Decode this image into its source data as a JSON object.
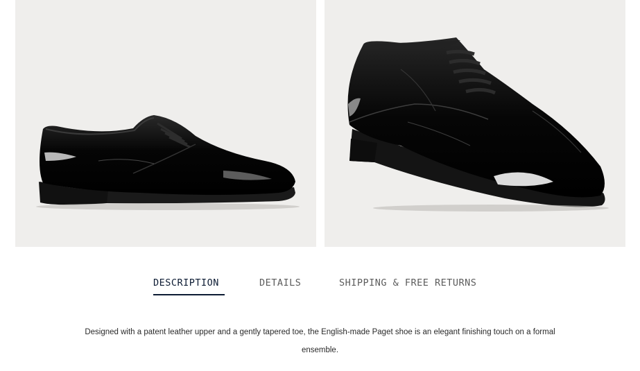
{
  "gallery": {
    "images": [
      {
        "name": "shoe-side-view"
      },
      {
        "name": "shoe-three-quarter-view"
      }
    ]
  },
  "tabs": [
    {
      "label": "DESCRIPTION",
      "active": true
    },
    {
      "label": "DETAILS",
      "active": false
    },
    {
      "label": "SHIPPING & FREE RETURNS",
      "active": false
    }
  ],
  "description": {
    "text": "Designed with a patent leather upper and a gently tapered toe, the English-made Paget shoe is an elegant finishing touch on a formal ensemble."
  },
  "colors": {
    "panel_bg": "#efeeec",
    "active_tab": "#0c1b33",
    "inactive_tab": "#5c5c5c"
  }
}
